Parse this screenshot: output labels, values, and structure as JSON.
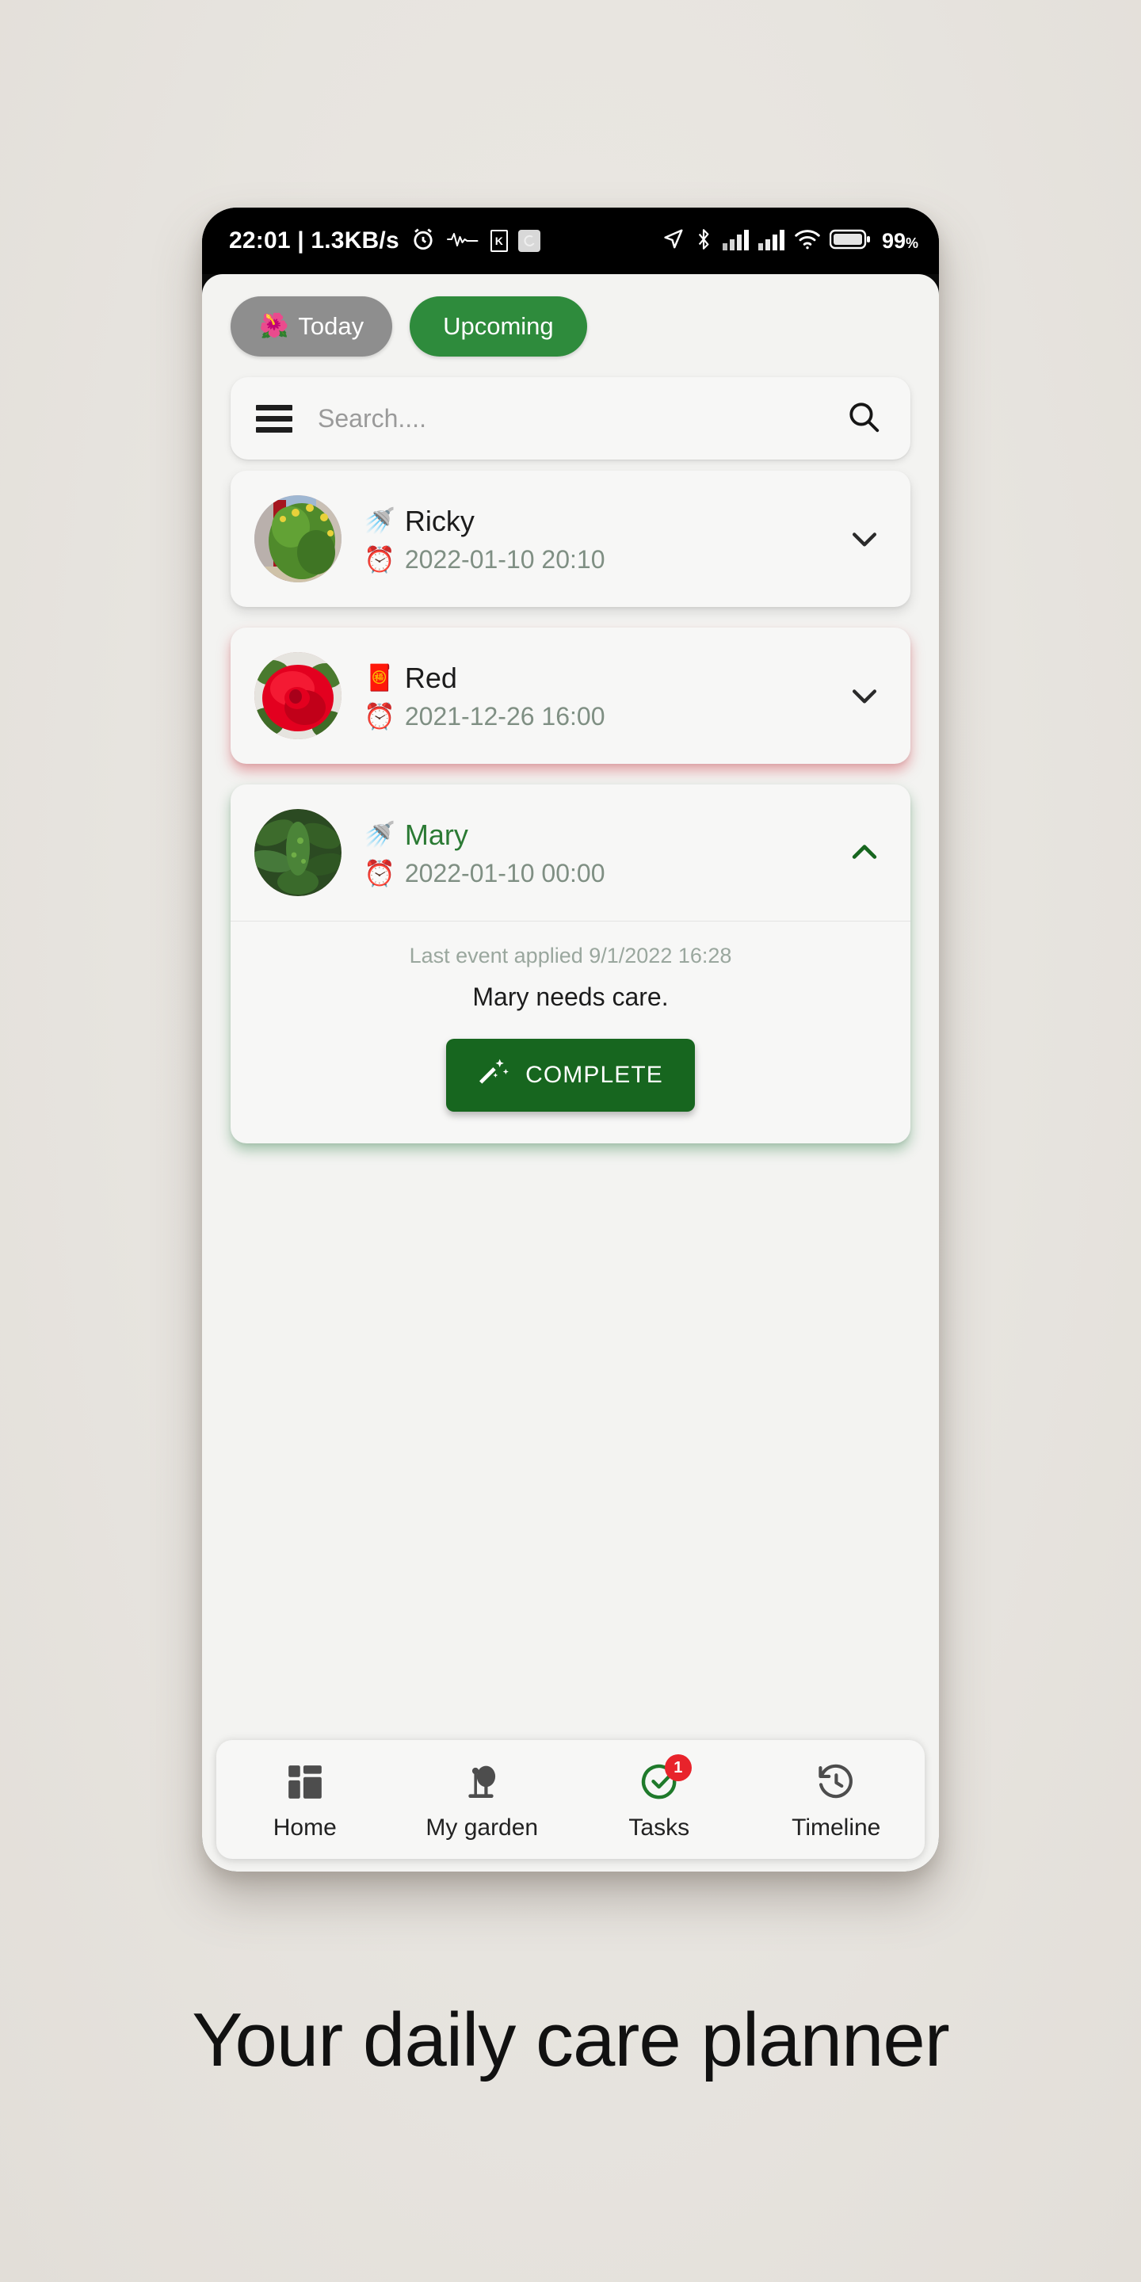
{
  "status_bar": {
    "clock": "22:01 | 1.3KB/s",
    "alarm_icon": "alarm-clock-icon",
    "waveform_icon": "waveform-icon",
    "k_badge": "K",
    "square_icon": "app-square-icon",
    "location_icon": "location-arrow-icon",
    "bluetooth_icon": "bluetooth-icon",
    "signal_icon_1": "signal-bars-icon",
    "signal_icon_2": "signal-bars-icon",
    "wifi_icon": "wifi-icon",
    "battery_icon": "battery-icon",
    "battery_level": "99",
    "battery_pct_sign": "%"
  },
  "tabs": {
    "today": {
      "label": "Today",
      "emoji": "🌺",
      "active": false,
      "bg": "#8e8e8e"
    },
    "upcoming": {
      "label": "Upcoming",
      "active": true,
      "bg": "#2e8b3c"
    }
  },
  "search": {
    "placeholder": "Search....",
    "value": "",
    "menu_icon": "hamburger-menu-icon",
    "search_icon": "search-icon"
  },
  "tasks": [
    {
      "name": "Ricky",
      "type_emoji": "🚿",
      "clock_emoji": "⏰",
      "datetime": "2022-01-10 20:10",
      "expanded": false,
      "chevron": "chevron-down-icon",
      "shadow": "neutral",
      "title_color": "#1c1c1c"
    },
    {
      "name": "Red",
      "type_emoji": "🧧",
      "clock_emoji": "⏰",
      "datetime": "2021-12-26 16:00",
      "expanded": false,
      "chevron": "chevron-down-icon",
      "shadow": "red",
      "title_color": "#1c1c1c"
    },
    {
      "name": "Mary",
      "type_emoji": "🚿",
      "clock_emoji": "⏰",
      "datetime": "2022-01-10 00:00",
      "expanded": true,
      "chevron": "chevron-up-icon",
      "shadow": "green",
      "title_color": "#2b7a34",
      "detail": {
        "last_event": "Last event applied 9/1/2022 16:28",
        "message": "Mary needs care.",
        "button_label": "COMPLETE",
        "button_icon": "magic-wand-icon",
        "button_color": "#17661f"
      }
    }
  ],
  "bottom_nav": [
    {
      "label": "Home",
      "icon": "dashboard-grid-icon",
      "active": false,
      "badge": null
    },
    {
      "label": "My garden",
      "icon": "tree-icon",
      "active": false,
      "badge": null
    },
    {
      "label": "Tasks",
      "icon": "check-circle-icon",
      "active": true,
      "badge": "1",
      "color": "#2b7a34"
    },
    {
      "label": "Timeline",
      "icon": "history-clock-icon",
      "active": false,
      "badge": null
    }
  ],
  "caption": {
    "text": "Your daily care planner"
  },
  "colors": {
    "accent_green": "#2e8b3c",
    "dark_green": "#17661f",
    "badge_red": "#e8232b",
    "canvas": "#e9e6e1"
  }
}
